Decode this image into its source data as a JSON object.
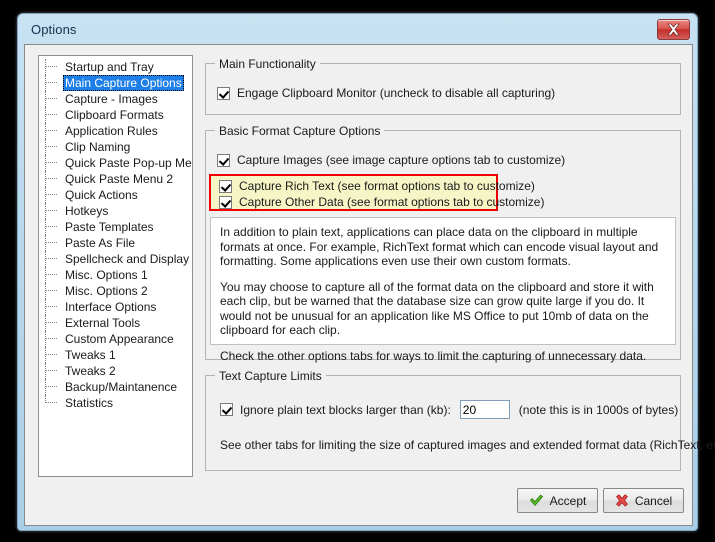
{
  "window": {
    "title": "Options",
    "close_icon": "close-x-icon"
  },
  "sidebar": {
    "items": [
      {
        "label": "Startup and Tray",
        "selected": false
      },
      {
        "label": "Main Capture Options",
        "selected": true
      },
      {
        "label": "Capture - Images",
        "selected": false
      },
      {
        "label": "Clipboard Formats",
        "selected": false
      },
      {
        "label": "Application Rules",
        "selected": false
      },
      {
        "label": "Clip Naming",
        "selected": false
      },
      {
        "label": "Quick Paste Pop-up Menu",
        "selected": false
      },
      {
        "label": "Quick Paste Menu 2",
        "selected": false
      },
      {
        "label": "Quick Actions",
        "selected": false
      },
      {
        "label": "Hotkeys",
        "selected": false
      },
      {
        "label": "Paste Templates",
        "selected": false
      },
      {
        "label": "Paste As File",
        "selected": false
      },
      {
        "label": "Spellcheck and Display",
        "selected": false
      },
      {
        "label": "Misc. Options 1",
        "selected": false
      },
      {
        "label": "Misc. Options 2",
        "selected": false
      },
      {
        "label": "Interface Options",
        "selected": false
      },
      {
        "label": "External Tools",
        "selected": false
      },
      {
        "label": "Custom Appearance",
        "selected": false
      },
      {
        "label": "Tweaks 1",
        "selected": false
      },
      {
        "label": "Tweaks 2",
        "selected": false
      },
      {
        "label": "Backup/Maintanence",
        "selected": false
      },
      {
        "label": "Statistics",
        "selected": false
      }
    ]
  },
  "main_functionality": {
    "title": "Main Functionality",
    "engage_monitor": {
      "label": "Engage Clipboard Monitor (uncheck to disable all capturing)",
      "checked": true
    }
  },
  "basic_format": {
    "title": "Basic Format Capture Options",
    "capture_images": {
      "label": "Capture Images (see image capture options tab to customize)",
      "checked": true
    },
    "capture_rich_text": {
      "label": "Capture Rich Text (see format options tab to customize)",
      "checked": true
    },
    "capture_other_data": {
      "label": "Capture Other Data (see format options tab to customize)",
      "checked": true
    },
    "highlight_color": "#f5f5c6",
    "highlight_border_color": "#f00000",
    "description": {
      "p1": "In addition to plain text, applications can place data on the clipboard in multiple formats at once. For example, RichText format which can encode visual layout and formatting.  Some applications even use their own custom formats.",
      "p2": "You may choose to capture all of the format data on the clipboard and store it with each clip, but be warned that the database size can grow quite large if you do.  It would not be unusual for an application like MS Office to put 10mb of data on the clipboard for each clip.",
      "p3": "Check the other options tabs for ways to limit the capturing of unnecessary data."
    }
  },
  "text_capture_limits": {
    "title": "Text Capture Limits",
    "ignore_blocks": {
      "label": "Ignore plain text blocks larger than (kb):",
      "checked": true,
      "value": "20",
      "note": "(note this is in 1000s of bytes)"
    },
    "footer_note": "See other tabs for limiting the size of captured images and extended format data (RichText, etc.)"
  },
  "footer": {
    "accept_label": "Accept",
    "cancel_label": "Cancel",
    "accept_icon": "green-check-icon",
    "cancel_icon": "red-x-icon",
    "accept_color": "#4caf1f",
    "cancel_color": "#e03636"
  }
}
